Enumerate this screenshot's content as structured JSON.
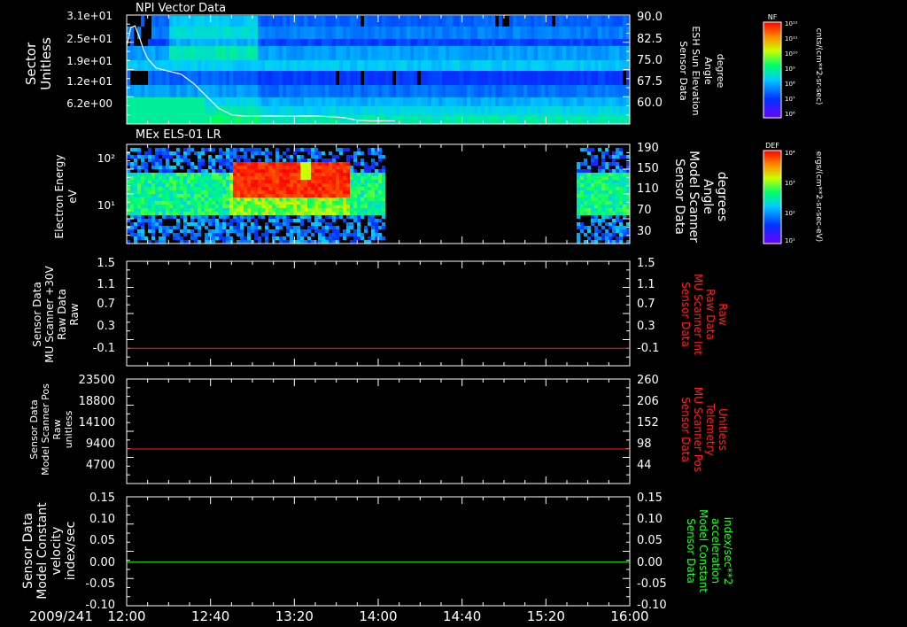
{
  "date_label": "2009/241",
  "x_axis": {
    "start_minutes": 0,
    "end_minutes": 240,
    "tick_labels": [
      "12:00",
      "12:40",
      "13:20",
      "14:00",
      "14:40",
      "15:20",
      "16:00"
    ]
  },
  "colors": {
    "background": "#000000",
    "axis": "#ffffff",
    "red_series": "#ff2020",
    "green_series": "#20ff20",
    "right_label_red": "#ff2020",
    "right_label_green": "#20ff20"
  },
  "panels": [
    {
      "id": "npi",
      "title": "NPI Vector Data",
      "left_label": [
        "Sector",
        "Unitless"
      ],
      "left_ticks": [
        "3.1e+01",
        "2.5e+01",
        "1.9e+01",
        "1.2e+01",
        "6.2e+00"
      ],
      "right_label": [
        "Sensor Data",
        "ESH Sun Elevation",
        "Angle",
        "degree"
      ],
      "right_ticks": [
        "90.0",
        "82.5",
        "75.0",
        "67.5",
        "60.0"
      ],
      "colorbar": {
        "title": "NF",
        "unit": "cnts/(cm**2-sr-sec)",
        "tick_labels": [
          "10¹²",
          "10¹¹",
          "10¹⁰",
          "10⁹",
          "10⁸",
          "10⁷",
          "10⁶"
        ]
      }
    },
    {
      "id": "els",
      "title": "MEx ELS-01 LR",
      "left_label": [
        "Electron Energy",
        "eV"
      ],
      "left_ticks": [
        "10²",
        "10¹"
      ],
      "right_label": [
        "Sensor Data",
        "Model Scanner",
        "Angle",
        "degrees"
      ],
      "right_ticks": [
        "190",
        "150",
        "110",
        "70",
        "30"
      ],
      "colorbar": {
        "title": "DEF",
        "unit": "ergs/(cm**2-sr-sec-eV)",
        "tick_labels": [
          "10⁴",
          "10³",
          "10²",
          "10¹"
        ]
      }
    },
    {
      "id": "mu30",
      "left_label": [
        "Sensor Data",
        "MU Scanner +30V",
        "Raw Data",
        "Raw"
      ],
      "left_ticks": [
        "1.5",
        "1.1",
        "0.7",
        "0.3",
        "-0.1"
      ],
      "right_label": [
        "Sensor Data",
        "MU Scanner Int",
        "Raw Data",
        "Raw"
      ],
      "right_ticks": [
        "1.5",
        "1.1",
        "0.7",
        "0.3",
        "-0.1"
      ]
    },
    {
      "id": "pos",
      "left_label": [
        "Sensor Data",
        "Model Scanner Pos",
        "Raw",
        "unitless"
      ],
      "left_ticks": [
        "23500",
        "18800",
        "14100",
        "9400",
        "4700"
      ],
      "right_label": [
        "Sensor Data",
        "MU Scanner Pos",
        "Telemetry",
        "Unitless"
      ],
      "right_ticks": [
        "260",
        "206",
        "152",
        "98",
        "44"
      ]
    },
    {
      "id": "vel",
      "left_label": [
        "Sensor Data",
        "Model Constant",
        "velocity",
        "index/sec"
      ],
      "left_ticks": [
        "0.15",
        "0.10",
        "0.05",
        "0.00",
        "-0.05",
        "-0.10"
      ],
      "right_label": [
        "Sensor Data",
        "Model Constant",
        "acceleration",
        "index/sec**2"
      ],
      "right_ticks": [
        "0.15",
        "0.10",
        "0.05",
        "0.00",
        "-0.05",
        "-0.10"
      ]
    }
  ],
  "chart_data": [
    {
      "type": "heatmap",
      "title": "NPI Vector Data",
      "ylabel": "Sector Unitless",
      "y_ticks": [
        "3.1e+01",
        "2.5e+01",
        "1.9e+01",
        "1.2e+01",
        "6.2e+00"
      ],
      "y2label": "Sensor Data ESH Sun Elevation Angle degree",
      "y2_ticks": [
        90.0,
        82.5,
        75.0,
        67.5,
        60.0
      ],
      "y2lim": [
        55,
        90
      ],
      "overlay_line": {
        "name": "ESH Sun Elevation",
        "x_minutes": [
          0,
          2,
          4,
          6,
          8,
          10,
          14,
          20,
          26,
          32,
          38,
          44,
          50,
          56,
          62,
          68,
          74,
          80,
          86,
          92,
          98,
          104,
          110,
          116,
          122,
          128
        ],
        "y_deg": [
          80,
          86,
          86.5,
          83,
          79,
          76,
          73,
          72,
          71,
          68,
          64,
          60,
          58,
          57.5,
          57.5,
          57.6,
          57.5,
          57.5,
          57.6,
          57.5,
          57.3,
          57.0,
          56.2,
          56.0,
          56.0,
          56.0
        ]
      },
      "colorbar": {
        "label": "NF",
        "unit": "cnts/(cm**2-sr-sec)",
        "range": [
          1000000.0,
          1000000000000.0
        ]
      }
    },
    {
      "type": "heatmap",
      "title": "MEx ELS-01 LR",
      "ylabel": "Electron Energy eV",
      "y_ticks": [
        "10¹",
        "10²"
      ],
      "y2label": "Sensor Data Model Scanner Angle degrees",
      "y2_ticks": [
        190,
        150,
        110,
        70,
        30
      ],
      "data_gap_minutes": [
        [
          123,
          213
        ]
      ],
      "colorbar": {
        "label": "DEF",
        "unit": "ergs/(cm**2-sr-sec-eV)",
        "range": [
          10.0,
          10000.0
        ]
      }
    },
    {
      "type": "line",
      "ylabel": "Sensor Data MU Scanner +30V Raw Data Raw",
      "ylim": [
        -0.3,
        1.5
      ],
      "y2label": "Sensor Data MU Scanner Int Raw Data Raw",
      "series": [
        {
          "name": "MU Scanner Int Raw Data",
          "x_minutes": [
            0,
            240
          ],
          "values": [
            0.0,
            0.0
          ]
        }
      ]
    },
    {
      "type": "line",
      "ylabel": "Sensor Data Model Scanner Pos Raw unitless",
      "ylim": [
        0,
        23500
      ],
      "y2label": "Sensor Data MU Scanner Pos Telemetry Unitless",
      "y2lim": [
        0,
        260
      ],
      "series": [
        {
          "name": "MU Scanner Pos Telemetry",
          "x_minutes": [
            0,
            240
          ],
          "values": [
            86,
            86
          ]
        }
      ]
    },
    {
      "type": "line",
      "ylabel": "Sensor Data Model Constant velocity index/sec",
      "ylim": [
        -0.1,
        0.15
      ],
      "y2label": "Sensor Data Model Constant acceleration index/sec**2",
      "series": [
        {
          "name": "Model Constant acceleration",
          "x_minutes": [
            0,
            240
          ],
          "values": [
            0.0,
            0.0
          ]
        }
      ]
    }
  ]
}
